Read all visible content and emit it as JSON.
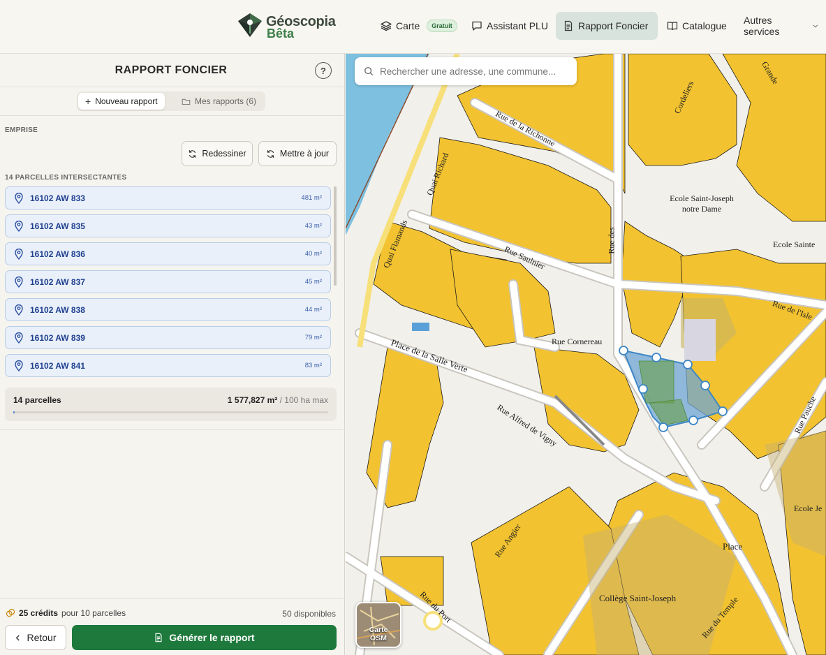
{
  "header": {
    "logo_title": "Géoscopia",
    "logo_sub": "Bêta",
    "nav": [
      {
        "label": "Carte",
        "badge": "Gratuit",
        "icon": "layers-icon"
      },
      {
        "label": "Assistant PLU",
        "icon": "chat-icon"
      },
      {
        "label": "Rapport Foncier",
        "icon": "document-icon",
        "active": true
      },
      {
        "label": "Catalogue",
        "icon": "book-icon"
      },
      {
        "label": "Autres services",
        "icon": "chevron-down-icon"
      }
    ]
  },
  "sidebar": {
    "title": "RAPPORT FONCIER",
    "help": "?",
    "tabs": [
      {
        "label": "Nouveau rapport",
        "active": true
      },
      {
        "label": "Mes rapports (6)",
        "active": false
      }
    ],
    "emprise_label": "EMPRISE",
    "redraw_label": "Redessiner",
    "update_label": "Mettre à jour",
    "parcels_label": "14 PARCELLES INTERSECTANTES",
    "parcels": [
      {
        "id": "16102 AW 833",
        "area": "481 m²"
      },
      {
        "id": "16102 AW 835",
        "area": "43 m²"
      },
      {
        "id": "16102 AW 836",
        "area": "40 m²"
      },
      {
        "id": "16102 AW 837",
        "area": "45 m²"
      },
      {
        "id": "16102 AW 838",
        "area": "44 m²"
      },
      {
        "id": "16102 AW 839",
        "area": "79 m²"
      },
      {
        "id": "16102 AW 841",
        "area": "83 m²"
      }
    ],
    "summary": {
      "count": "14 parcelles",
      "area": "1 577,827 m²",
      "max": " / 100 ha max",
      "progress_fraction": 0.0016
    },
    "credits": {
      "amount": "25 crédits",
      "rest": "pour 10 parcelles",
      "available": "50 disponibles"
    },
    "back_label": "Retour",
    "generate_label": "Générer le rapport"
  },
  "map": {
    "search_placeholder": "Rechercher une adresse, une commune...",
    "layer_button": "Carte OSM",
    "labels": {
      "rue_richonne": "Rue de la Richonne",
      "quai_richard": "Quai Richard",
      "quai_flamands": "Quai Flamands",
      "rue_saulnier": "Rue Saulnier",
      "ecole_sj": "Ecole Saint-Joseph notre Dame",
      "ecole_sainte": "Ecole Sainte",
      "cordeliers": "Cordeliers",
      "grande": "Grande",
      "place_salle_verte": "Place de la Salle Verte",
      "rue_alfred_vigny": "Rue Alfred de Vigny",
      "rue_cornereau": "Rue Cornereau",
      "rue_des": "Rue des",
      "place": "Place",
      "college": "Collège Saint-Joseph",
      "ecole_je": "Ecole Je",
      "rue_angier": "Rue Angier",
      "rue_du_port": "Rue du Port",
      "rue_du_temple": "Rue du Temple",
      "rue_de_lisle": "Rue de l'Isle",
      "rue_pauche": "Rue Pauche"
    }
  }
}
